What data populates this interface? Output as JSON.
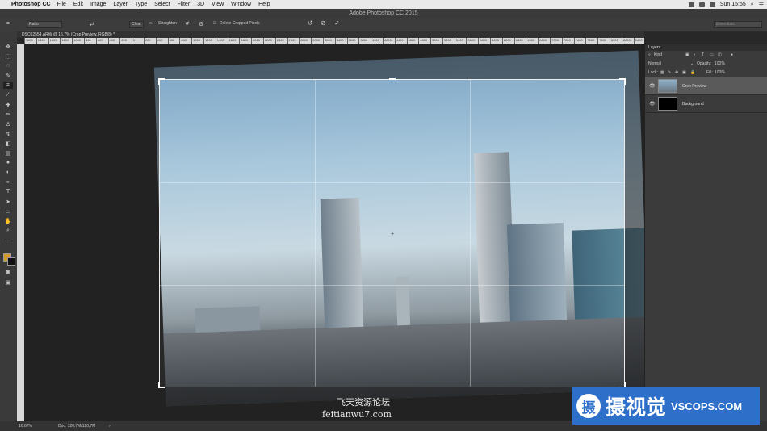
{
  "menubar": {
    "app": "Photoshop CC",
    "items": [
      "File",
      "Edit",
      "Image",
      "Layer",
      "Type",
      "Select",
      "Filter",
      "3D",
      "View",
      "Window",
      "Help"
    ],
    "clock": "Sun 15:55"
  },
  "window_title": "Adobe Photoshop CC 2015",
  "options_bar": {
    "ratio_label": "Ratio",
    "clear_label": "Clear",
    "straighten_label": "Straighten",
    "delete_cropped_label": "Delete Cropped Pixels",
    "workspace_label": "Essentials"
  },
  "document_tab": "DSC02554.ARW @ 16,7% (Crop Preview, RGB/8) *",
  "ruler_ticks": [
    "1800",
    "1600",
    "1400",
    "1200",
    "1000",
    "800",
    "600",
    "400",
    "200",
    "0",
    "200",
    "400",
    "600",
    "800",
    "1000",
    "1200",
    "1400",
    "1600",
    "1800",
    "2000",
    "2200",
    "2400",
    "2600",
    "2800",
    "3000",
    "3200",
    "3400",
    "3600",
    "3800",
    "4000",
    "4200",
    "4400",
    "4600",
    "4800",
    "5000",
    "5200",
    "5400",
    "5600",
    "5800",
    "6000",
    "6200",
    "6400",
    "6600",
    "6800",
    "7000",
    "7200",
    "7400",
    "7600",
    "7800",
    "8000",
    "8200",
    "8400"
  ],
  "tools": [
    "move-tool",
    "marquee-tool",
    "lasso-tool",
    "quick-select-tool",
    "crop-tool",
    "eyedropper-tool",
    "healing-tool",
    "brush-tool",
    "stamp-tool",
    "history-brush-tool",
    "eraser-tool",
    "gradient-tool",
    "blur-tool",
    "dodge-tool",
    "pen-tool",
    "type-tool",
    "path-select-tool",
    "shape-tool",
    "hand-tool",
    "zoom-tool"
  ],
  "layers_panel": {
    "title": "Layers",
    "kind_label": "Kind",
    "blend_mode": "Normal",
    "opacity_label": "Opacity:",
    "opacity_value": "100%",
    "lock_label": "Lock:",
    "fill_label": "Fill:",
    "fill_value": "100%",
    "layers": [
      {
        "name": "Crop Preview",
        "selected": true
      },
      {
        "name": "Background",
        "selected": false
      }
    ]
  },
  "status": {
    "zoom": "16.67%",
    "doc": "Doc: 120,7M/120,7M"
  },
  "watermark": {
    "line1": "飞天资源论坛",
    "line2": "feitianwu7.com"
  },
  "badge": {
    "logo_char": "摄",
    "cn": "摄视觉",
    "en": "VSCOPS.COM"
  },
  "colors": {
    "foreground": "#d59b2a",
    "background": "#111111",
    "badge_blue": "#2d6fc9"
  }
}
